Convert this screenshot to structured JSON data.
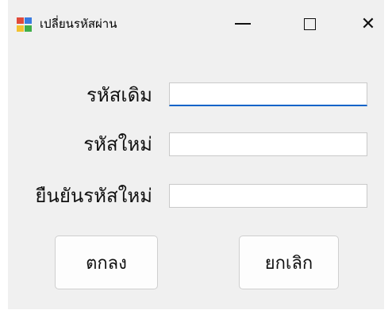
{
  "window": {
    "title": "เปลี่ยนรหัสผ่าน",
    "icon": "windows-forms-app-icon",
    "controls": {
      "minimize": "minimize-icon",
      "maximize": "maximize-icon",
      "close_glyph": "✕"
    }
  },
  "form": {
    "fields": [
      {
        "label": "รหัสเดิม",
        "value": "",
        "focused": true
      },
      {
        "label": "รหัสใหม่",
        "value": ""
      },
      {
        "label": "ยืนยันรหัสใหม่",
        "value": ""
      }
    ],
    "buttons": {
      "ok_label": "ตกลง",
      "cancel_label": "ยกเลิก"
    }
  },
  "colors": {
    "window_background": "#f0f0f0",
    "focus_underline": "#0a63c9",
    "field_border": "#c9c9c9"
  }
}
